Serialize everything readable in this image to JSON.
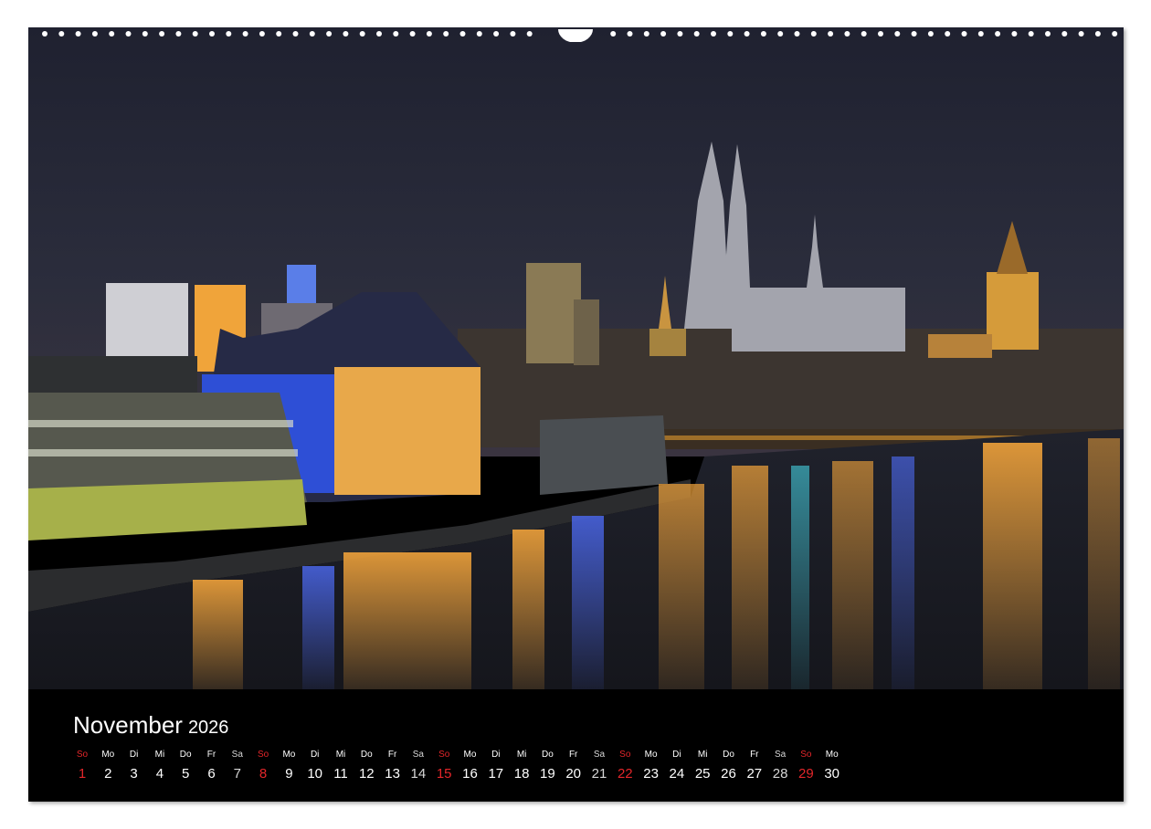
{
  "calendar": {
    "month": "November",
    "year": "2026",
    "day_names": [
      "So",
      "Mo",
      "Di",
      "Mi",
      "Do",
      "Fr",
      "Sa",
      "So",
      "Mo",
      "Di",
      "Mi",
      "Do",
      "Fr",
      "Sa",
      "So",
      "Mo",
      "Di",
      "Mi",
      "Do",
      "Fr",
      "Sa",
      "So",
      "Mo",
      "Di",
      "Mi",
      "Do",
      "Fr",
      "Sa",
      "So",
      "Mo"
    ],
    "day_numbers": [
      "1",
      "2",
      "3",
      "4",
      "5",
      "6",
      "7",
      "8",
      "9",
      "10",
      "11",
      "12",
      "13",
      "14",
      "15",
      "16",
      "17",
      "18",
      "19",
      "20",
      "21",
      "22",
      "23",
      "24",
      "25",
      "26",
      "27",
      "28",
      "29",
      "30"
    ],
    "weekend_colors": {
      "sunday": "#e3262a",
      "saturday": "#d7d7d7",
      "weekday": "#ffffff"
    }
  },
  "photo": {
    "sky_color": "#262838",
    "water_color": "#1a1a22",
    "cathedral_color": "#a8a8b0",
    "light_colors": [
      "#f2a93b",
      "#3b58e0",
      "#e8b84a",
      "#ffffff"
    ]
  }
}
